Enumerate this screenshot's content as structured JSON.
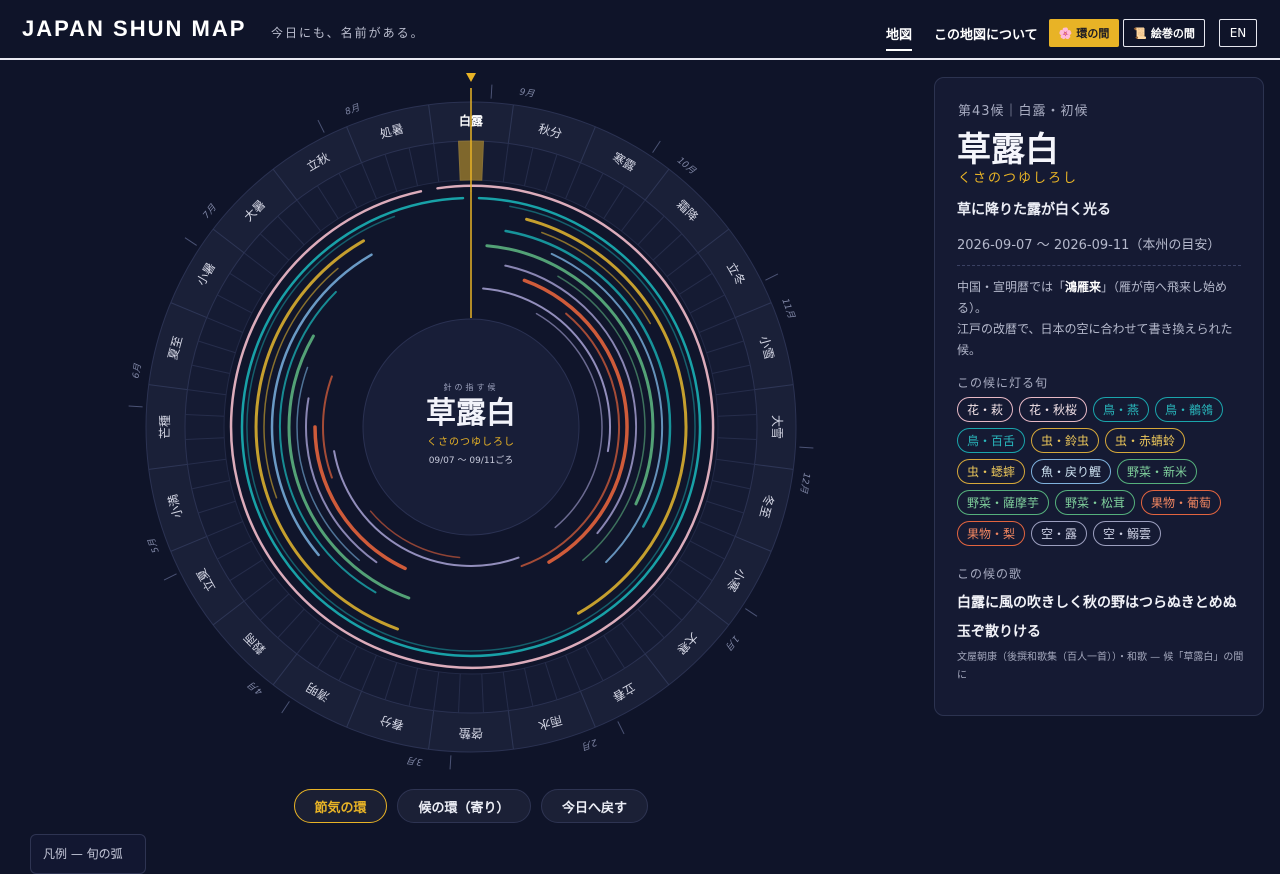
{
  "header": {
    "logo": "JAPAN SHUN MAP",
    "tagline": "今日にも、名前がある。",
    "nav": {
      "map": "地図",
      "about": "この地図について",
      "ring_room": "環の間",
      "scroll_room": "絵巻の間",
      "lang": "EN"
    },
    "ring_icon": "cherry-blossom-icon",
    "scroll_icon": "scroll-icon"
  },
  "wheel": {
    "sekki": [
      "白露",
      "秋分",
      "寒露",
      "霜降",
      "立冬",
      "小雪",
      "大雪",
      "冬至",
      "小寒",
      "大寒",
      "立春",
      "雨水",
      "啓蟄",
      "春分",
      "清明",
      "穀雨",
      "立夏",
      "小満",
      "芒種",
      "夏至",
      "小暑",
      "大暑",
      "立秋",
      "処暑"
    ],
    "months": [
      "9月",
      "10月",
      "11月",
      "12月",
      "1月",
      "2月",
      "3月",
      "4月",
      "5月",
      "6月",
      "7月",
      "8月"
    ],
    "center": {
      "note": "針の指す候",
      "name": "草露白",
      "kana": "くさのつゆしろし",
      "date": "09/07 〜 09/11ごろ"
    },
    "colors": {
      "accent": "#e8b326",
      "pink": "#e8b4c3",
      "teal": "#19a9ae",
      "gold": "#d9ae2f",
      "blue": "#7ab2e0",
      "green": "#5bb07e",
      "orange": "#e4633c",
      "lavender": "#a9a3d6"
    }
  },
  "controls": {
    "sekki_ring": "節気の環",
    "ko_ring": "候の環（寄り）",
    "today": "今日へ戻す"
  },
  "legend": {
    "title": "凡例 — 旬の弧"
  },
  "panel": {
    "header": "第43候｜白露・初候",
    "title": "草露白",
    "kana": "くさのつゆしろし",
    "meaning": "草に降りた露が白く光る",
    "date": "2026-09-07 〜 2026-09-11（本州の目安）",
    "desc_pre": "中国・宣明暦では「",
    "desc_bold": "鴻雁来",
    "desc_post": "」（雁が南へ飛来し始める）。",
    "desc_line2": "江戸の改暦で、日本の空に合わせて書き換えられた候。",
    "shun_heading": "この候に灯る旬",
    "shun": [
      {
        "label": "花・萩",
        "tone": "pink"
      },
      {
        "label": "花・秋桜",
        "tone": "pink"
      },
      {
        "label": "鳥・燕",
        "tone": "teal"
      },
      {
        "label": "鳥・鶺鴒",
        "tone": "teal"
      },
      {
        "label": "鳥・百舌",
        "tone": "teal"
      },
      {
        "label": "虫・鈴虫",
        "tone": "gold"
      },
      {
        "label": "虫・赤蜻蛉",
        "tone": "gold"
      },
      {
        "label": "虫・蟋蟀",
        "tone": "gold"
      },
      {
        "label": "魚・戻り鰹",
        "tone": "blue"
      },
      {
        "label": "野菜・新米",
        "tone": "green"
      },
      {
        "label": "野菜・薩摩芋",
        "tone": "green"
      },
      {
        "label": "野菜・松茸",
        "tone": "green"
      },
      {
        "label": "果物・葡萄",
        "tone": "orange"
      },
      {
        "label": "果物・梨",
        "tone": "orange"
      },
      {
        "label": "空・露",
        "tone": "lav"
      },
      {
        "label": "空・鰯雲",
        "tone": "lav"
      }
    ],
    "poem_heading": "この候の歌",
    "poem": "白露に風の吹きしく秋の野はつらぬきとめぬ玉ぞ散りける",
    "poem_source": "文屋朝康（後撰和歌集（百人一首））・和歌 — 候「草露白」の間に"
  }
}
